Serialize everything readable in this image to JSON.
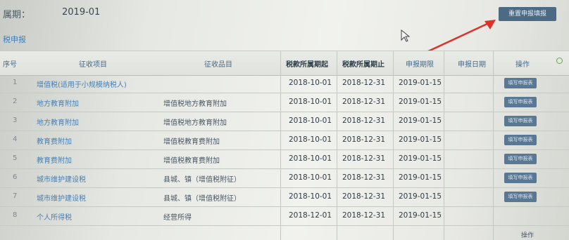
{
  "header": {
    "period_label": "属期：",
    "period_value": "2019-01",
    "reset_button_label": "重置申报填报"
  },
  "section": {
    "title": "税申报"
  },
  "table": {
    "columns": {
      "no": "序号",
      "item": "征收项目",
      "category": "征收品目",
      "period_start": "税款所属期起",
      "period_end": "税款所属期止",
      "deadline": "申报期限",
      "filed_date": "申报日期",
      "action": "操作"
    },
    "rows": [
      {
        "no": "1",
        "item": "增值税(适用于小规模纳税人)",
        "category": "",
        "start": "2018-10-01",
        "end": "2018-12-31",
        "due": "2019-01-15",
        "filed": "",
        "action": "填写申报表"
      },
      {
        "no": "2",
        "item": "地方教育附加",
        "category": "增值税地方教育附加",
        "start": "2018-10-01",
        "end": "2018-12-31",
        "due": "2019-01-15",
        "filed": "",
        "action": "填写申报表"
      },
      {
        "no": "3",
        "item": "地方教育附加",
        "category": "增值税地方教育附加",
        "start": "2018-10-01",
        "end": "2018-12-31",
        "due": "2019-01-15",
        "filed": "",
        "action": "填写申报表"
      },
      {
        "no": "4",
        "item": "教育费附加",
        "category": "增值税教育费附加",
        "start": "2018-10-01",
        "end": "2018-12-31",
        "due": "2019-01-15",
        "filed": "",
        "action": "填写申报表"
      },
      {
        "no": "5",
        "item": "教育费附加",
        "category": "增值税教育费附加",
        "start": "2018-10-01",
        "end": "2018-12-31",
        "due": "2019-01-15",
        "filed": "",
        "action": "填写申报表"
      },
      {
        "no": "6",
        "item": "城市维护建设税",
        "category": "县城、镇（增值税附征）",
        "start": "2018-10-01",
        "end": "2018-12-31",
        "due": "2019-01-15",
        "filed": "",
        "action": "填写申报表"
      },
      {
        "no": "7",
        "item": "城市维护建设税",
        "category": "县城、镇（增值税附征）",
        "start": "2018-10-01",
        "end": "2018-12-31",
        "due": "2019-01-15",
        "filed": "",
        "action": "填写申报表"
      },
      {
        "no": "8",
        "item": "个人所得税",
        "category": "经营所得",
        "start": "2018-12-01",
        "end": "2018-12-31",
        "due": "2019-01-15",
        "filed": "",
        "action": ""
      }
    ]
  },
  "footer": {
    "action_label": "操作"
  },
  "colors": {
    "button_bg": "#4d6a85",
    "arrow": "#e0302a",
    "link": "#4a7fb0"
  },
  "icons": {
    "cursor": "cursor-icon",
    "status": "status-dot-icon",
    "arrow": "annotation-arrow-icon"
  }
}
